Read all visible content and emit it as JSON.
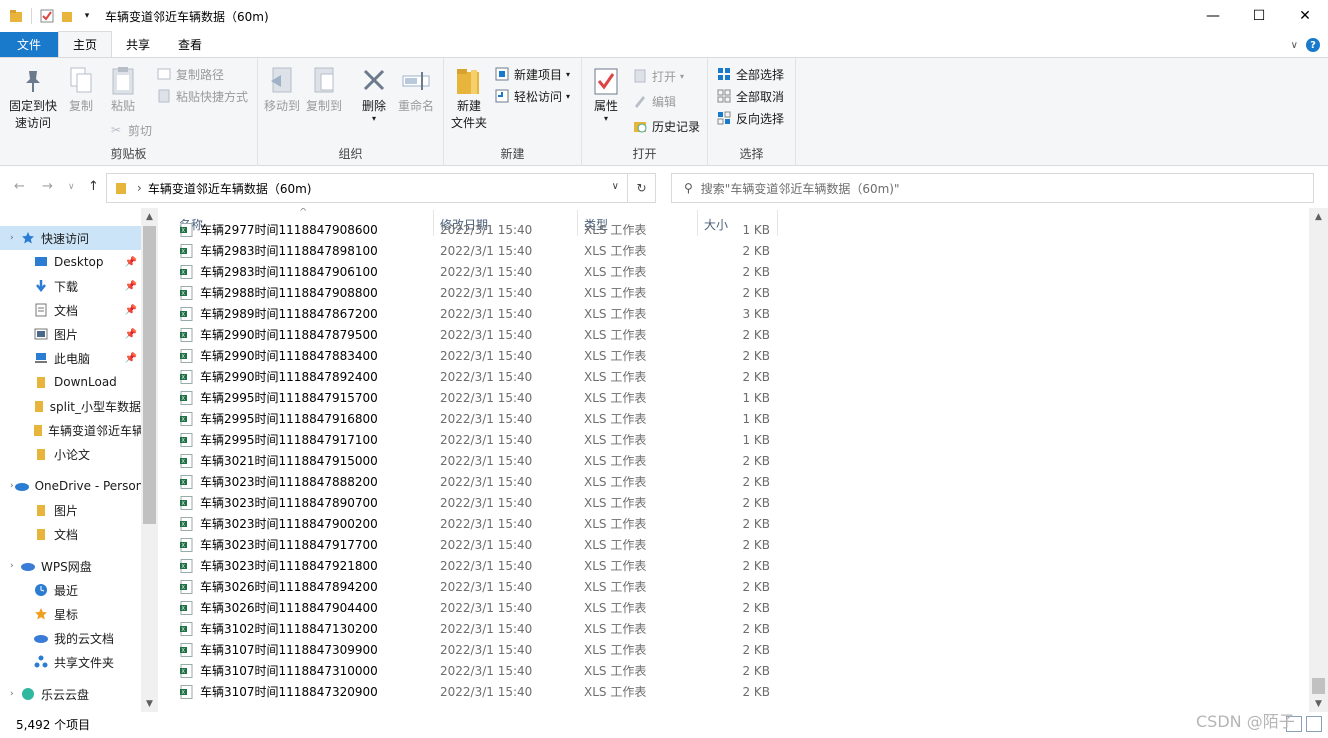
{
  "window": {
    "title": "车辆变道邻近车辆数据（60m)",
    "controls": {
      "minimize": "—",
      "maximize": "☐",
      "close": "✕"
    }
  },
  "tabs": [
    {
      "label": "文件"
    },
    {
      "label": "主页"
    },
    {
      "label": "共享"
    },
    {
      "label": "查看"
    }
  ],
  "ribbon": {
    "clipboard": {
      "label": "剪贴板",
      "pin_line1": "固定到快",
      "pin_line2": "速访问",
      "copy": "复制",
      "paste": "粘贴",
      "copy_path": "复制路径",
      "paste_shortcut": "粘贴快捷方式",
      "cut": "剪切"
    },
    "organize": {
      "label": "组织",
      "move_to": "移动到",
      "copy_to": "复制到",
      "delete": "删除",
      "rename": "重命名"
    },
    "new": {
      "label": "新建",
      "new_item": "新建项目",
      "easy_access": "轻松访问",
      "new_folder_line1": "新建",
      "new_folder_line2": "文件夹"
    },
    "open": {
      "label": "打开",
      "properties": "属性",
      "open": "打开",
      "edit": "编辑",
      "history": "历史记录"
    },
    "select": {
      "label": "选择",
      "select_all": "全部选择",
      "select_none": "全部取消",
      "invert": "反向选择"
    }
  },
  "address": {
    "separator": "›",
    "path": "车辆变道邻近车辆数据（60m)",
    "search_placeholder": "搜索\"车辆变道邻近车辆数据（60m)\""
  },
  "nav": {
    "items": [
      {
        "label": "快速访问",
        "icon": "star-icon"
      },
      {
        "label": "Desktop",
        "icon": "desktop-icon"
      },
      {
        "label": "下载",
        "icon": "download-icon"
      },
      {
        "label": "文档",
        "icon": "document-icon"
      },
      {
        "label": "图片",
        "icon": "picture-icon"
      },
      {
        "label": "此电脑",
        "icon": "computer-icon"
      },
      {
        "label": "DownLoad",
        "icon": "folder-icon"
      },
      {
        "label": "split_小型车数据",
        "icon": "folder-icon"
      },
      {
        "label": "车辆变道邻近车辆数据",
        "icon": "folder-icon"
      },
      {
        "label": "小论文",
        "icon": "folder-icon"
      },
      {
        "label": "OneDrive - Personal",
        "icon": "cloud-icon"
      },
      {
        "label": "图片",
        "icon": "folder-icon"
      },
      {
        "label": "文档",
        "icon": "folder-icon"
      },
      {
        "label": "WPS网盘",
        "icon": "cloud-icon"
      },
      {
        "label": "最近",
        "icon": "clock-icon"
      },
      {
        "label": "星标",
        "icon": "star-icon"
      },
      {
        "label": "我的云文档",
        "icon": "cloud-icon"
      },
      {
        "label": "共享文件夹",
        "icon": "share-icon"
      },
      {
        "label": "乐云云盘",
        "icon": "cloud-icon"
      }
    ]
  },
  "columns": {
    "name": "名称",
    "date": "修改日期",
    "type": "类型",
    "size": "大小"
  },
  "files": [
    {
      "name": "车辆2977时间1118847908600",
      "date": "2022/3/1 15:40",
      "type": "XLS 工作表",
      "size": "1 KB"
    },
    {
      "name": "车辆2983时间1118847898100",
      "date": "2022/3/1 15:40",
      "type": "XLS 工作表",
      "size": "2 KB"
    },
    {
      "name": "车辆2983时间1118847906100",
      "date": "2022/3/1 15:40",
      "type": "XLS 工作表",
      "size": "2 KB"
    },
    {
      "name": "车辆2988时间1118847908800",
      "date": "2022/3/1 15:40",
      "type": "XLS 工作表",
      "size": "2 KB"
    },
    {
      "name": "车辆2989时间1118847867200",
      "date": "2022/3/1 15:40",
      "type": "XLS 工作表",
      "size": "3 KB"
    },
    {
      "name": "车辆2990时间1118847879500",
      "date": "2022/3/1 15:40",
      "type": "XLS 工作表",
      "size": "2 KB"
    },
    {
      "name": "车辆2990时间1118847883400",
      "date": "2022/3/1 15:40",
      "type": "XLS 工作表",
      "size": "2 KB"
    },
    {
      "name": "车辆2990时间1118847892400",
      "date": "2022/3/1 15:40",
      "type": "XLS 工作表",
      "size": "2 KB"
    },
    {
      "name": "车辆2995时间1118847915700",
      "date": "2022/3/1 15:40",
      "type": "XLS 工作表",
      "size": "1 KB"
    },
    {
      "name": "车辆2995时间1118847916800",
      "date": "2022/3/1 15:40",
      "type": "XLS 工作表",
      "size": "1 KB"
    },
    {
      "name": "车辆2995时间1118847917100",
      "date": "2022/3/1 15:40",
      "type": "XLS 工作表",
      "size": "1 KB"
    },
    {
      "name": "车辆3021时间1118847915000",
      "date": "2022/3/1 15:40",
      "type": "XLS 工作表",
      "size": "2 KB"
    },
    {
      "name": "车辆3023时间1118847888200",
      "date": "2022/3/1 15:40",
      "type": "XLS 工作表",
      "size": "2 KB"
    },
    {
      "name": "车辆3023时间1118847890700",
      "date": "2022/3/1 15:40",
      "type": "XLS 工作表",
      "size": "2 KB"
    },
    {
      "name": "车辆3023时间1118847900200",
      "date": "2022/3/1 15:40",
      "type": "XLS 工作表",
      "size": "2 KB"
    },
    {
      "name": "车辆3023时间1118847917700",
      "date": "2022/3/1 15:40",
      "type": "XLS 工作表",
      "size": "2 KB"
    },
    {
      "name": "车辆3023时间1118847921800",
      "date": "2022/3/1 15:40",
      "type": "XLS 工作表",
      "size": "2 KB"
    },
    {
      "name": "车辆3026时间1118847894200",
      "date": "2022/3/1 15:40",
      "type": "XLS 工作表",
      "size": "2 KB"
    },
    {
      "name": "车辆3026时间1118847904400",
      "date": "2022/3/1 15:40",
      "type": "XLS 工作表",
      "size": "2 KB"
    },
    {
      "name": "车辆3102时间1118847130200",
      "date": "2022/3/1 15:40",
      "type": "XLS 工作表",
      "size": "2 KB"
    },
    {
      "name": "车辆3107时间1118847309900",
      "date": "2022/3/1 15:40",
      "type": "XLS 工作表",
      "size": "2 KB"
    },
    {
      "name": "车辆3107时间1118847310000",
      "date": "2022/3/1 15:40",
      "type": "XLS 工作表",
      "size": "2 KB"
    },
    {
      "name": "车辆3107时间1118847320900",
      "date": "2022/3/1 15:40",
      "type": "XLS 工作表",
      "size": "2 KB"
    }
  ],
  "status": {
    "count": "5,492 个项目"
  },
  "watermark": "CSDN @陌子",
  "colors": {
    "accent": "#1979ca",
    "selected": "#cce4f7",
    "folder": "#e8b53c"
  }
}
